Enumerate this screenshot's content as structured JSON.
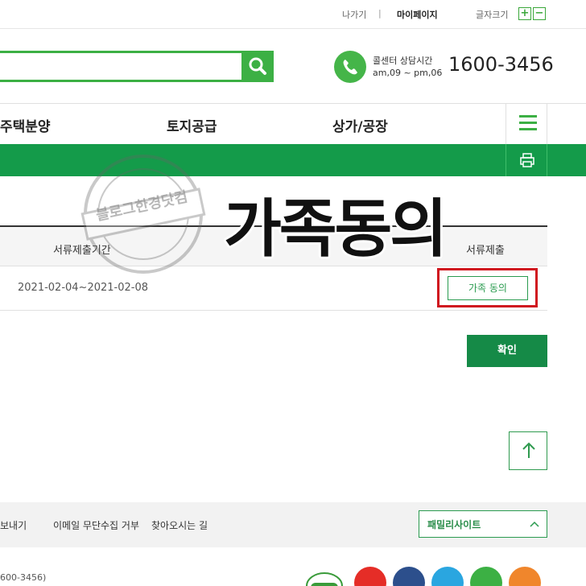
{
  "util": {
    "logout": "나가기",
    "separator": "|",
    "mypage": "마이페이지",
    "font_size": "글자크기",
    "font_plus": "+",
    "font_minus": "−"
  },
  "header": {
    "search_placeholder": "",
    "call_center_title": "콜센터 상담시간",
    "call_center_hours": "am,09 ~ pm,06",
    "call_center_phone": "1600-3456"
  },
  "nav": {
    "items": [
      "주택분양",
      "토지공급",
      "상가/공장"
    ]
  },
  "overlay": {
    "headline": "가족동의",
    "stamp_text": "블로그한경닷컴"
  },
  "table": {
    "columns": [
      "서류제출기간",
      "서류제출"
    ],
    "rows": [
      {
        "period": "2021-02-04~2021-02-08",
        "action": "가족 동의"
      }
    ]
  },
  "confirm_label": "확인",
  "footer": {
    "links": [
      "보내기",
      "이메일 무단수집 거부",
      "찾아오시는 길"
    ],
    "family_site": "패밀리사이트",
    "phone_text": "600-3456)"
  },
  "colors": {
    "green": "#3cb044",
    "dark_green": "#149b4a",
    "highlight_red": "#d0161f"
  },
  "social_icons": [
    "youtube-icon",
    "facebook-icon",
    "twitter-icon",
    "blog-icon",
    "rss-icon"
  ]
}
